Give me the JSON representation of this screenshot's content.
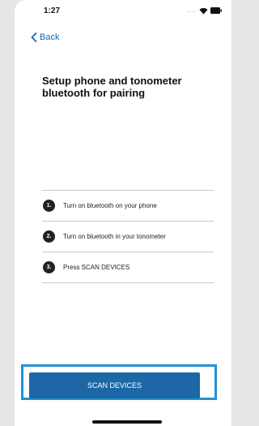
{
  "status_bar": {
    "time": "1:27",
    "signal_text": "....",
    "icons": [
      "wifi-icon",
      "battery-icon"
    ]
  },
  "nav": {
    "back_label": "Back",
    "back_icon": "chevron-left-icon"
  },
  "page": {
    "title": "Setup phone and tonometer bluetooth for pairing"
  },
  "steps": [
    {
      "number": "1.",
      "text": "Turn on bluetooth on your phone"
    },
    {
      "number": "2.",
      "text": "Turn on bluetooth in your tonometer"
    },
    {
      "number": "3.",
      "text": "Press SCAN DEVICES"
    }
  ],
  "actions": {
    "scan_label": "SCAN DEVICES"
  },
  "colors": {
    "accent": "#1368b6",
    "button": "#1d67a6",
    "highlight": "#1e94d2"
  }
}
